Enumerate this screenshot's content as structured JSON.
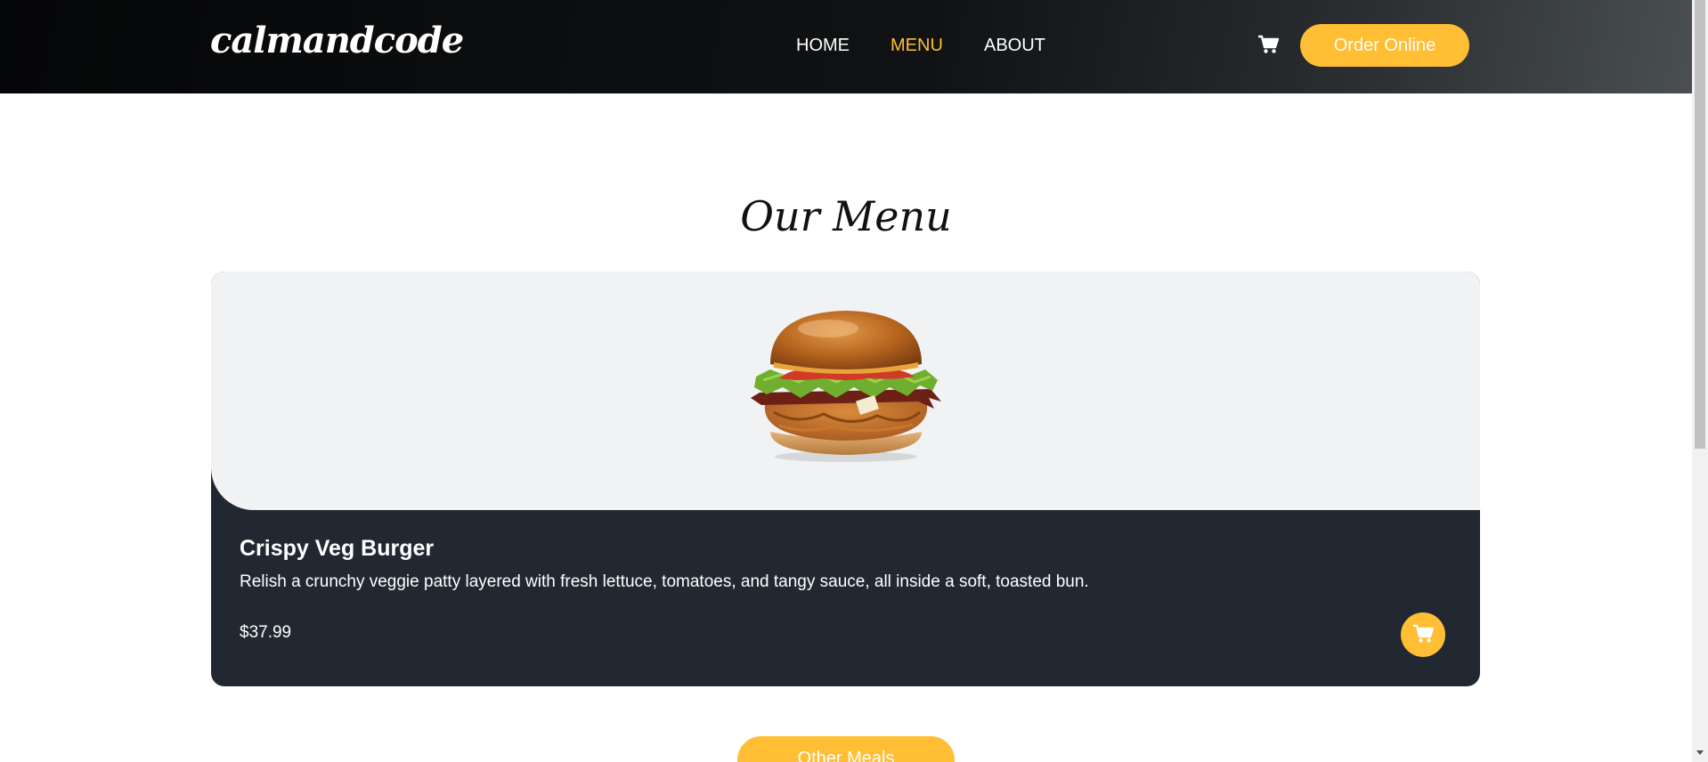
{
  "brand": {
    "logo_text": "calmandcode"
  },
  "nav": {
    "links": [
      {
        "label": "HOME",
        "active": false
      },
      {
        "label": "MENU",
        "active": true
      },
      {
        "label": "ABOUT",
        "active": false
      }
    ],
    "cart_icon": "cart-icon",
    "order_label": "Order Online"
  },
  "menu": {
    "title": "Our Menu",
    "items": [
      {
        "name": "Crispy Veg Burger",
        "description": "Relish a crunchy veggie patty layered with fresh lettuce, tomatoes, and tangy sauce, all inside a soft, toasted bun.",
        "price": "$37.99",
        "image_icon": "burger-image",
        "cart_icon": "cart-icon"
      }
    ],
    "other_button_label": "Other Meals"
  },
  "colors": {
    "accent": "#ffbe33",
    "card_dark": "#222831",
    "image_bg": "#f1f2f3",
    "nav_bg": "#0c0e10"
  }
}
